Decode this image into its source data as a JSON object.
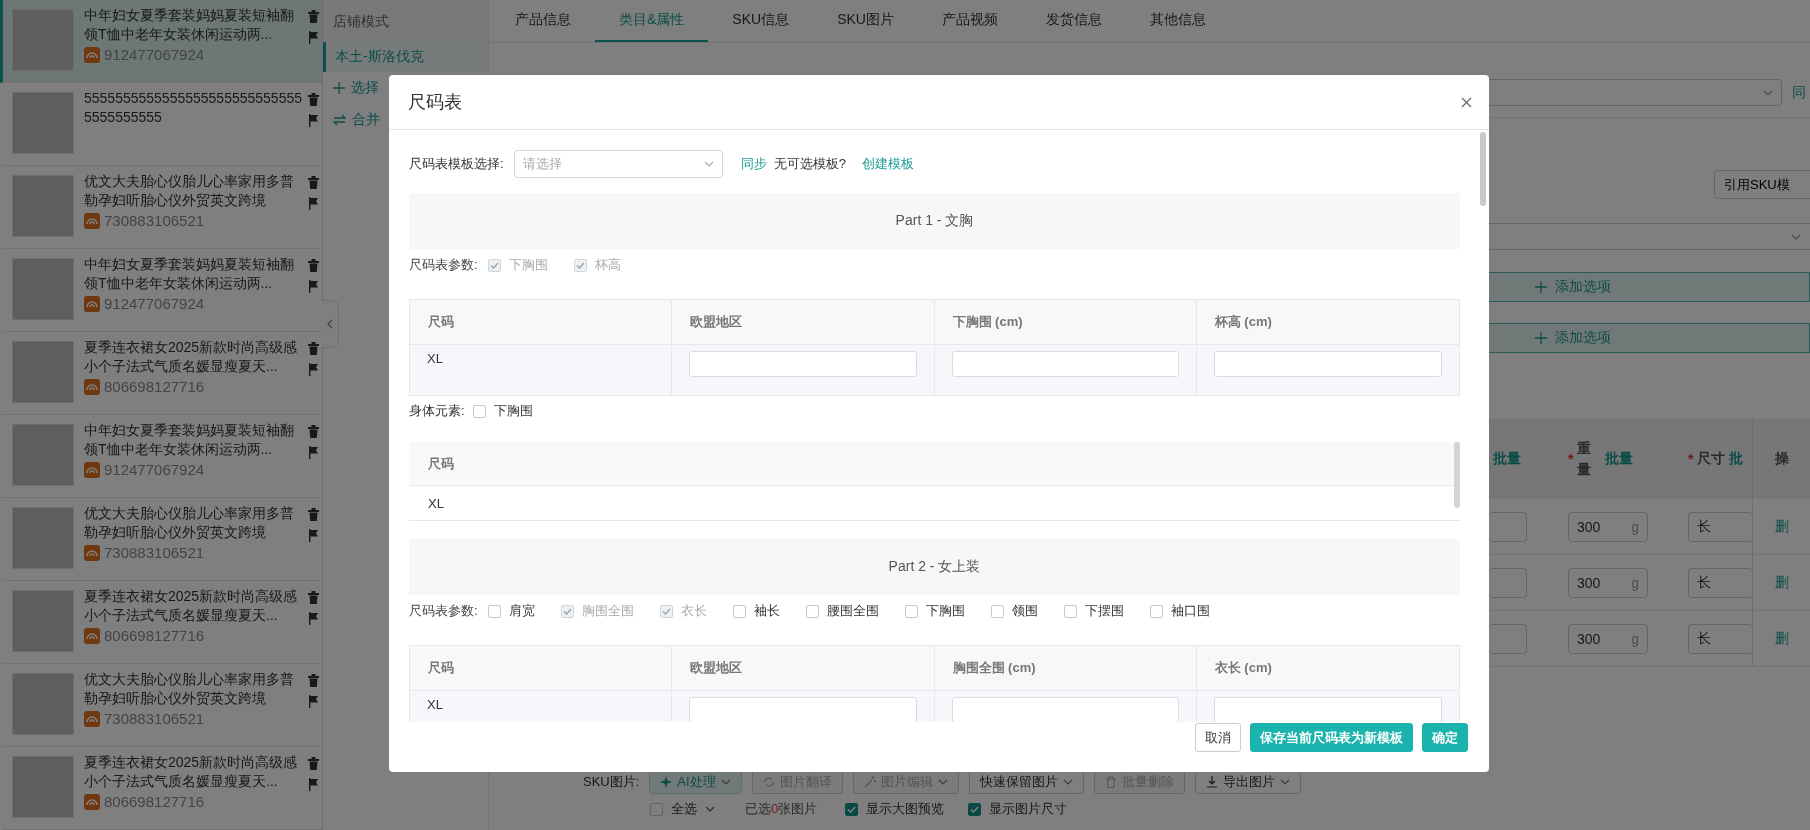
{
  "sidebar": {
    "products": [
      {
        "title": "中年妇女夏季套装妈妈夏装短袖翻领T恤中老年女装休闲运动两...",
        "id": "912477067924",
        "selected": true
      },
      {
        "title": "55555555555555555555555555555555555555",
        "selected": false
      },
      {
        "title": "优文大夫胎心仪胎儿心率家用多普勒孕妇听胎心仪外贸英文跨境",
        "id": "730883106521",
        "selected": false
      },
      {
        "title": "中年妇女夏季套装妈妈夏装短袖翻领T恤中老年女装休闲运动两...",
        "id": "912477067924",
        "selected": false
      },
      {
        "title": "夏季连衣裙女2025新款时尚高级感小个子法式气质名媛显瘦夏天...",
        "id": "806698127716",
        "selected": false
      },
      {
        "title": "中年妇女夏季套装妈妈夏装短袖翻领T恤中老年女装休闲运动两...",
        "id": "912477067924",
        "selected": false
      },
      {
        "title": "优文大夫胎心仪胎儿心率家用多普勒孕妇听胎心仪外贸英文跨境",
        "id": "730883106521",
        "selected": false
      },
      {
        "title": "夏季连衣裙女2025新款时尚高级感小个子法式气质名媛显瘦夏天...",
        "id": "806698127716",
        "selected": false
      },
      {
        "title": "优文大夫胎心仪胎儿心率家用多普勒孕妇听胎心仪外贸英文跨境",
        "id": "730883106521",
        "selected": false
      },
      {
        "title": "夏季连衣裙女2025新款时尚高级感小个子法式气质名媛显瘦夏天...",
        "id": "806698127716",
        "selected": false
      }
    ]
  },
  "shop_panel": {
    "header": "店铺模式",
    "shops": [
      {
        "label": "本土-斯洛伐克",
        "selected": true
      }
    ],
    "actions": [
      {
        "kind": "add",
        "label": "选择"
      },
      {
        "kind": "merge",
        "label": "合并"
      }
    ]
  },
  "tabs": [
    {
      "label": "产品信息",
      "selected": false
    },
    {
      "label": "类目&属性",
      "selected": true
    },
    {
      "label": "SKU信息",
      "selected": false
    },
    {
      "label": "SKU图片",
      "selected": false
    },
    {
      "label": "产品视频",
      "selected": false
    },
    {
      "label": "发货信息",
      "selected": false
    },
    {
      "label": "其他信息",
      "selected": false
    }
  ],
  "background": {
    "sync_link": "同",
    "template_button": "引用SKU模",
    "add_option_buttons": [
      "添加选项",
      "添加选项"
    ],
    "sku_table": {
      "columns": [
        {
          "batch": "批量"
        },
        {
          "required_mark": "*",
          "label": "重量",
          "batch": "批量"
        },
        {
          "required_mark": "*",
          "label": "尺寸",
          "batch": "批"
        },
        {
          "label": "操"
        }
      ],
      "rows": [
        {
          "weight": "300",
          "unit": "g",
          "size_prefix": "长",
          "action": "删"
        },
        {
          "weight": "300",
          "unit": "g",
          "size_prefix": "长",
          "action": "删"
        },
        {
          "weight": "300",
          "unit": "g",
          "size_prefix": "长",
          "action": "删"
        }
      ]
    },
    "image_toolbar": {
      "label": "SKU图片:",
      "buttons": [
        {
          "kind": "ai",
          "label": "AI处理",
          "dropdown": true,
          "disabled": false
        },
        {
          "kind": "translate",
          "label": "图片翻译",
          "dropdown": false,
          "disabled": true
        },
        {
          "kind": "edit",
          "label": "图片编辑",
          "dropdown": true,
          "disabled": true
        },
        {
          "kind": "plain",
          "label": "快速保留图片",
          "dropdown": true,
          "disabled": false
        },
        {
          "kind": "delete",
          "label": "批量删除",
          "dropdown": false,
          "disabled": true
        },
        {
          "kind": "export",
          "label": "导出图片",
          "dropdown": true,
          "disabled": false
        }
      ],
      "select_all": {
        "label": "全选",
        "checked": false
      },
      "selection": {
        "prefix": "已选",
        "count": "0",
        "suffix": "张图片"
      },
      "options": [
        {
          "label": "显示大图预览",
          "checked": true
        },
        {
          "label": "显示图片尺寸",
          "checked": true
        }
      ]
    }
  },
  "modal": {
    "title": "尺码表",
    "template_select": {
      "label": "尺码表模板选择:",
      "placeholder": "请选择"
    },
    "sync_link": "同步",
    "no_template_text": "无可选模板?",
    "create_link": "创建模板",
    "parts": [
      {
        "title": "Part 1 - 文胸",
        "params_label": "尺码表参数:",
        "params": [
          {
            "label": "下胸围",
            "checked": true,
            "disabled": true
          },
          {
            "label": "杯高",
            "checked": true,
            "disabled": true
          }
        ],
        "table": {
          "columns": [
            "尺码",
            "欧盟地区",
            "下胸围 (cm)",
            "杯高 (cm)"
          ],
          "rows": [
            {
              "size": "XL"
            }
          ]
        },
        "body_elements": {
          "label": "身体元素:",
          "options": [
            {
              "label": "下胸围",
              "checked": false,
              "disabled": false
            }
          ],
          "table": {
            "columns": [
              "尺码"
            ],
            "rows": [
              {
                "size": "XL"
              }
            ]
          }
        }
      },
      {
        "title": "Part 2 - 女上装",
        "params_label": "尺码表参数:",
        "params": [
          {
            "label": "肩宽",
            "checked": false,
            "disabled": false
          },
          {
            "label": "胸围全围",
            "checked": true,
            "disabled": true
          },
          {
            "label": "衣长",
            "checked": true,
            "disabled": true
          },
          {
            "label": "袖长",
            "checked": false,
            "disabled": false
          },
          {
            "label": "腰围全围",
            "checked": false,
            "disabled": false
          },
          {
            "label": "下胸围",
            "checked": false,
            "disabled": false
          },
          {
            "label": "领围",
            "checked": false,
            "disabled": false
          },
          {
            "label": "下摆围",
            "checked": false,
            "disabled": false
          },
          {
            "label": "袖口围",
            "checked": false,
            "disabled": false
          }
        ],
        "table": {
          "columns": [
            "尺码",
            "欧盟地区",
            "胸围全围 (cm)",
            "衣长 (cm)"
          ],
          "rows": [
            {
              "size": "XL"
            }
          ]
        }
      }
    ],
    "footer_buttons": [
      {
        "label": "取消",
        "kind": "default"
      },
      {
        "label": "保存当前尺码表为新模板",
        "kind": "primary"
      },
      {
        "label": "确定",
        "kind": "primary"
      }
    ]
  }
}
